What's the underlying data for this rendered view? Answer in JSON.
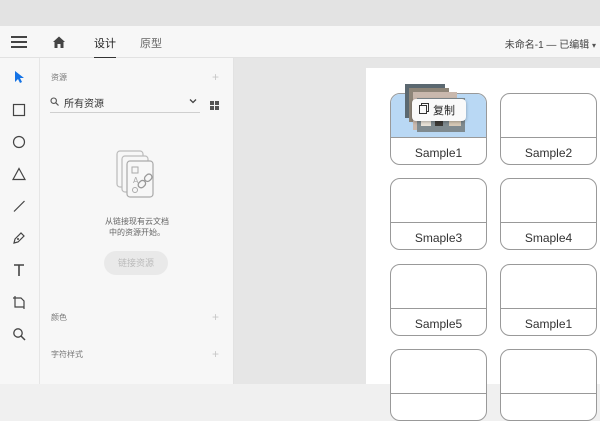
{
  "header": {
    "tabs": [
      {
        "label": "设计",
        "active": true
      },
      {
        "label": "原型",
        "active": false
      }
    ],
    "doc_title": "未命名-1 — 已编辑"
  },
  "assets_panel": {
    "title": "资源",
    "filter_value": "所有资源",
    "empty_text_line1": "从链接现有云文档",
    "empty_text_line2": "中的资源开始。",
    "link_button_label": "链接资源",
    "colors_title": "颜色",
    "char_styles_title": "字符样式"
  },
  "canvas": {
    "cards": [
      {
        "label": "Sample1",
        "selected": true
      },
      {
        "label": "Sample2",
        "selected": false
      },
      {
        "label": "Smaple3",
        "selected": false
      },
      {
        "label": "Smaple4",
        "selected": false
      },
      {
        "label": "Sample5",
        "selected": false
      },
      {
        "label": "Sample1",
        "selected": false
      },
      {
        "label": "",
        "selected": false
      },
      {
        "label": "",
        "selected": false
      }
    ],
    "copy_tooltip": "复制"
  },
  "colors": {
    "accent": "#1473e6",
    "selection_fill": "#b9d8f4"
  }
}
